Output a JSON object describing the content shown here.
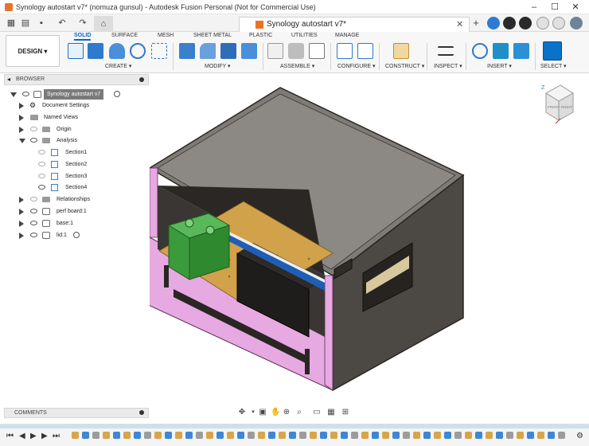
{
  "window": {
    "title": "Synology autostart v7* (nomuza gunsul) - Autodesk Fusion Personal (Not for Commercial Use)",
    "minimize": "–",
    "maximize": "☐",
    "close": "✕"
  },
  "document_tab": {
    "name": "Synology autostart v7*",
    "close": "✕"
  },
  "ribbon": {
    "workspace_label": "DESIGN",
    "tabs": [
      "SOLID",
      "SURFACE",
      "MESH",
      "SHEET METAL",
      "PLASTIC",
      "UTILITIES",
      "MANAGE"
    ],
    "active_tab": "SOLID",
    "groups": [
      "CREATE",
      "MODIFY",
      "ASSEMBLE",
      "CONFIGURE",
      "CONSTRUCT",
      "INSPECT",
      "INSERT",
      "SELECT"
    ]
  },
  "browser": {
    "header": "BROWSER",
    "root": "Synology autostart v7",
    "items": [
      {
        "label": "Document Settings"
      },
      {
        "label": "Named Views"
      },
      {
        "label": "Origin"
      },
      {
        "label": "Analysis"
      },
      {
        "label": "Section1"
      },
      {
        "label": "Section2"
      },
      {
        "label": "Section3"
      },
      {
        "label": "Section4"
      },
      {
        "label": "Relationships"
      },
      {
        "label": "perf board:1"
      },
      {
        "label": "base:1"
      },
      {
        "label": "lid:1"
      }
    ]
  },
  "viewcube": {
    "axis_z": "Z",
    "face_front": "FRONT",
    "face_right": "RIGHT"
  },
  "comments": {
    "header": "COMMENTS"
  },
  "colors": {
    "accent": "#0a67c2",
    "section_fill": "#e6a6e0",
    "box_dark": "#4a4642",
    "board": "#d1a24a",
    "terminal": "#3b9a3b",
    "highlight": "#1e5fb5"
  }
}
